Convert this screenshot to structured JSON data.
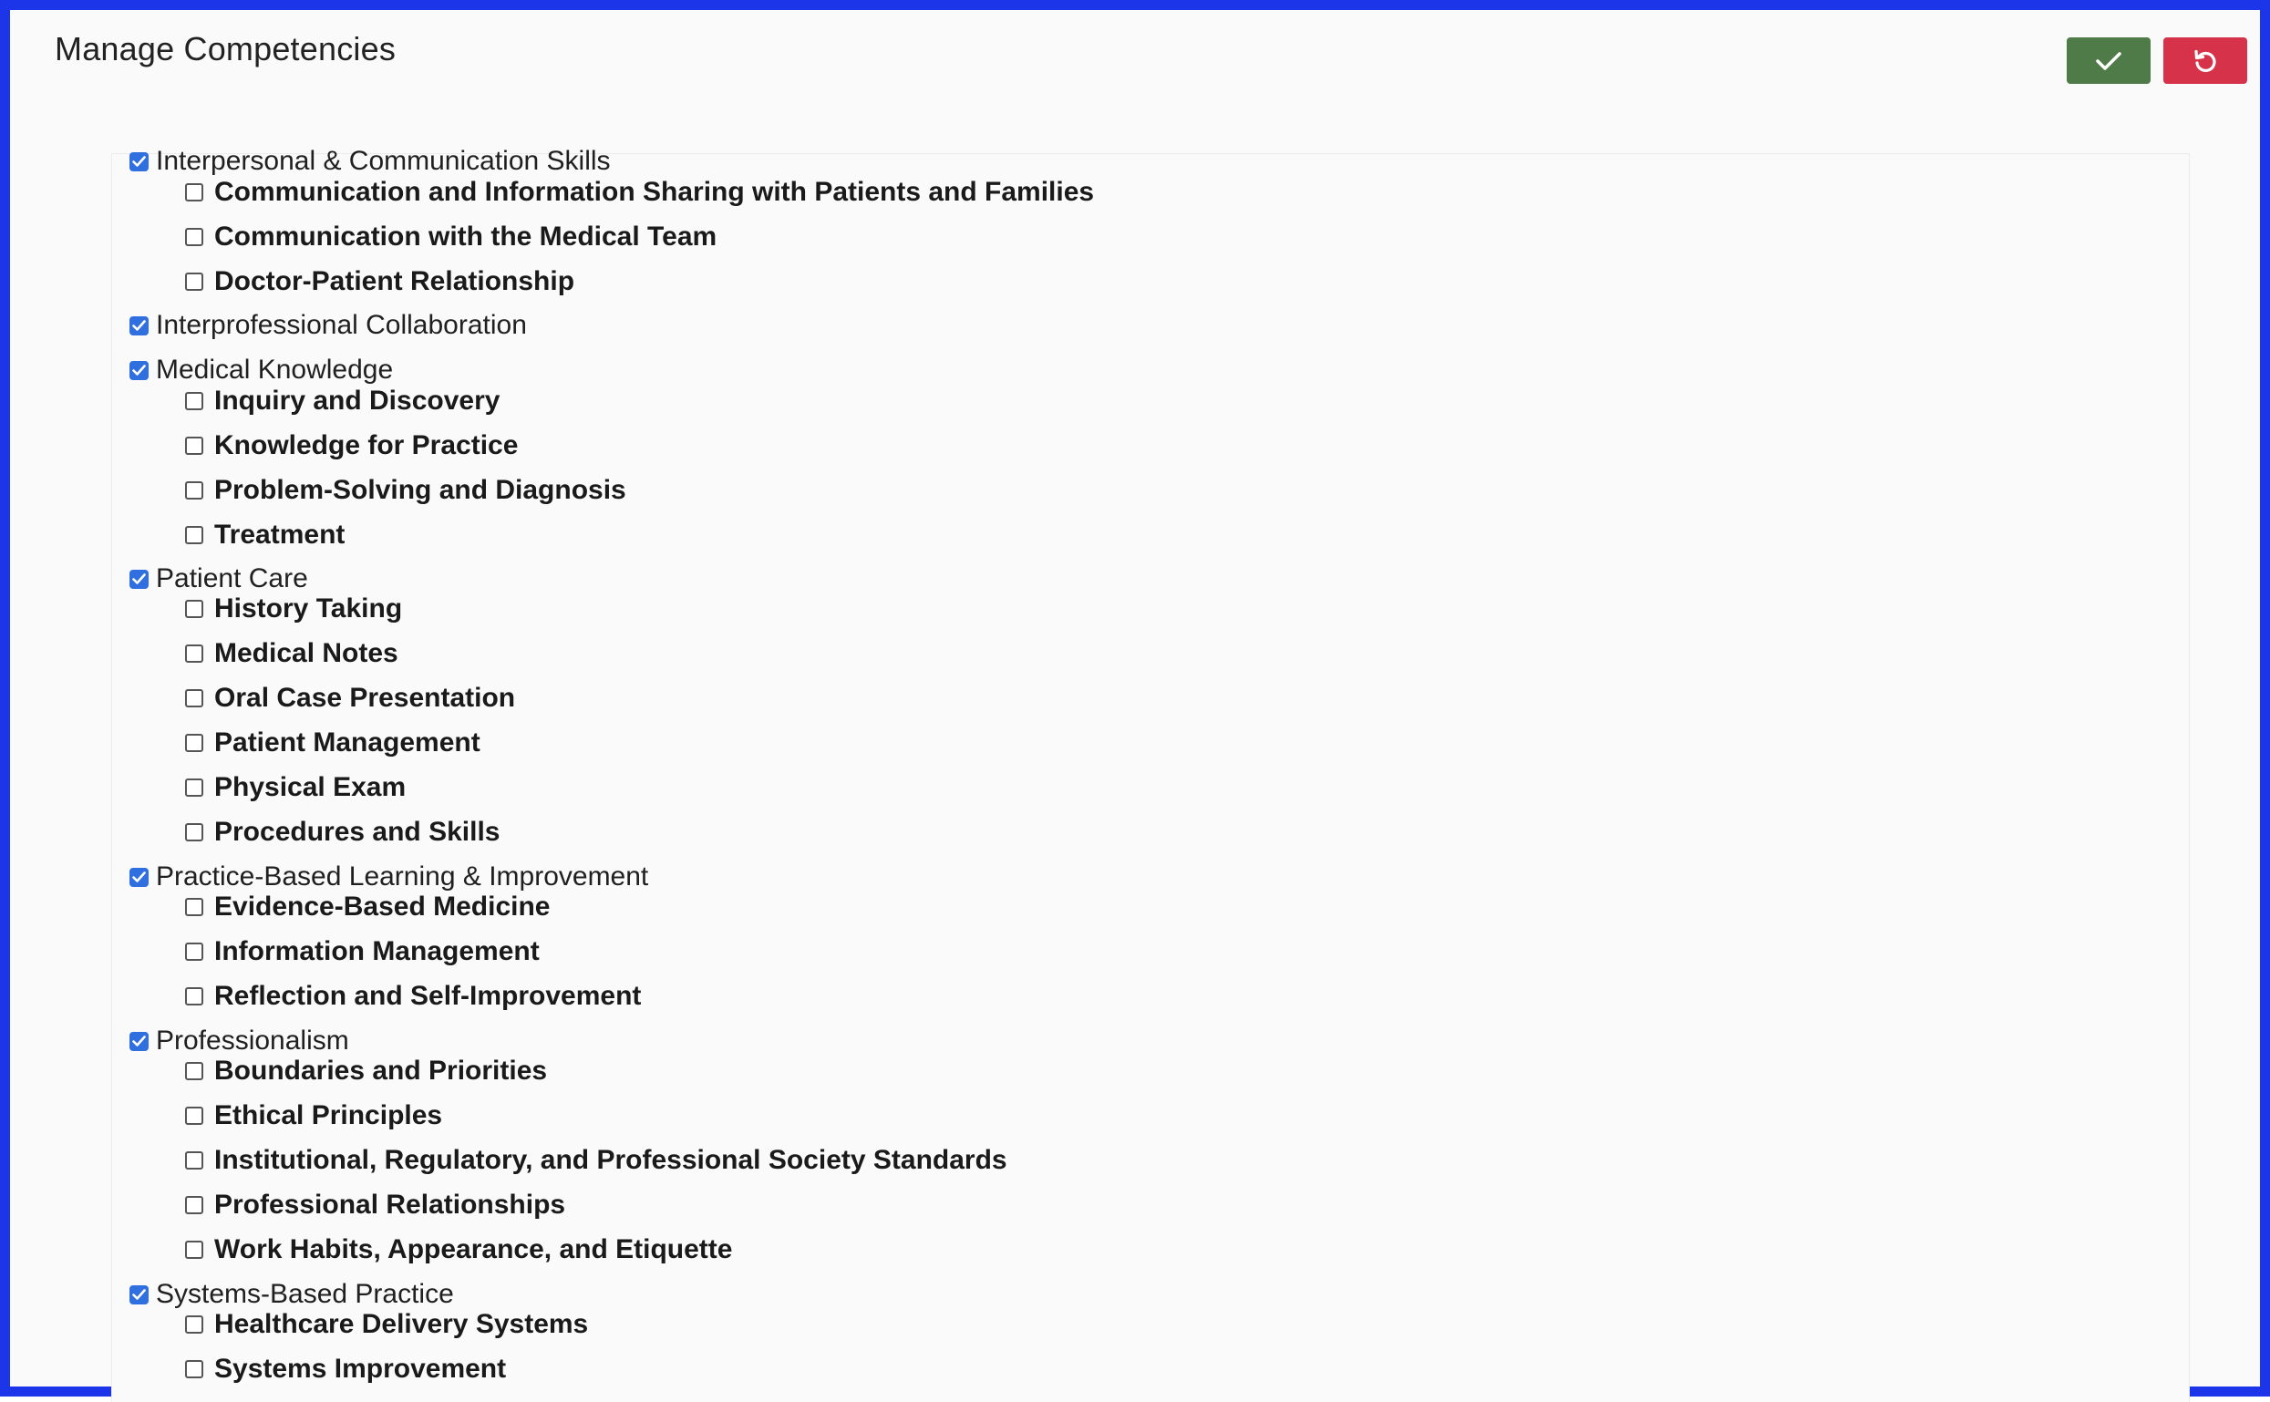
{
  "header": {
    "title": "Manage Competencies",
    "save_icon": "check-icon",
    "reset_icon": "undo-icon",
    "save_color": "#4e7b47",
    "reset_color": "#d6334a",
    "frame_color": "#1c35e8",
    "checkbox_color": "#2f6fdf"
  },
  "categories": [
    {
      "label": "Interpersonal & Communication Skills",
      "checked": true,
      "items": [
        {
          "label": "Communication and Information Sharing with Patients and Families",
          "checked": false
        },
        {
          "label": "Communication with the Medical Team",
          "checked": false
        },
        {
          "label": "Doctor-Patient Relationship",
          "checked": false
        }
      ]
    },
    {
      "label": "Interprofessional Collaboration",
      "checked": true,
      "items": []
    },
    {
      "label": "Medical Knowledge",
      "checked": true,
      "items": [
        {
          "label": "Inquiry and Discovery",
          "checked": false
        },
        {
          "label": "Knowledge for Practice",
          "checked": false
        },
        {
          "label": "Problem-Solving and Diagnosis",
          "checked": false
        },
        {
          "label": "Treatment",
          "checked": false
        }
      ]
    },
    {
      "label": "Patient Care",
      "checked": true,
      "items": [
        {
          "label": "History Taking",
          "checked": false
        },
        {
          "label": "Medical Notes",
          "checked": false
        },
        {
          "label": "Oral Case Presentation",
          "checked": false
        },
        {
          "label": "Patient Management",
          "checked": false
        },
        {
          "label": "Physical Exam",
          "checked": false
        },
        {
          "label": "Procedures and Skills",
          "checked": false
        }
      ]
    },
    {
      "label": "Practice-Based Learning & Improvement",
      "checked": true,
      "items": [
        {
          "label": "Evidence-Based Medicine",
          "checked": false
        },
        {
          "label": "Information Management",
          "checked": false
        },
        {
          "label": "Reflection and Self-Improvement",
          "checked": false
        }
      ]
    },
    {
      "label": "Professionalism",
      "checked": true,
      "items": [
        {
          "label": "Boundaries and Priorities",
          "checked": false
        },
        {
          "label": "Ethical Principles",
          "checked": false
        },
        {
          "label": "Institutional, Regulatory, and Professional Society Standards",
          "checked": false
        },
        {
          "label": "Professional Relationships",
          "checked": false
        },
        {
          "label": "Work Habits, Appearance, and Etiquette",
          "checked": false
        }
      ]
    },
    {
      "label": "Systems-Based Practice",
      "checked": true,
      "items": [
        {
          "label": "Healthcare Delivery Systems",
          "checked": false
        },
        {
          "label": "Systems Improvement",
          "checked": false
        }
      ]
    }
  ]
}
